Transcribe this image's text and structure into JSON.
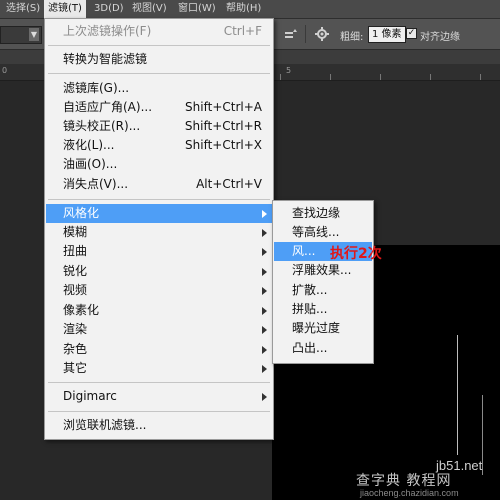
{
  "menubar": {
    "items": [
      {
        "label": "选择(S)"
      },
      {
        "label": "滤镜(T)"
      },
      {
        "label": "3D(D)"
      },
      {
        "label": "视图(V)"
      },
      {
        "label": "窗口(W)"
      },
      {
        "label": "帮助(H)"
      }
    ]
  },
  "options": {
    "width_label": "粗细:",
    "width_value": "1 像素",
    "align_edges_label": "对齐边缘",
    "align_edges_checked": "✓"
  },
  "ruler": {
    "numbers": [
      "0",
      "5"
    ]
  },
  "filter_menu": {
    "items": [
      {
        "label": "上次滤镜操作(F)",
        "shortcut": "Ctrl+F"
      },
      {
        "label": "转换为智能滤镜",
        "shortcut": ""
      },
      {
        "label": "滤镜库(G)...",
        "shortcut": ""
      },
      {
        "label": "自适应广角(A)...",
        "shortcut": "Shift+Ctrl+A"
      },
      {
        "label": "镜头校正(R)...",
        "shortcut": "Shift+Ctrl+R"
      },
      {
        "label": "液化(L)...",
        "shortcut": "Shift+Ctrl+X"
      },
      {
        "label": "油画(O)...",
        "shortcut": ""
      },
      {
        "label": "消失点(V)...",
        "shortcut": "Alt+Ctrl+V"
      },
      {
        "label": "风格化",
        "shortcut": ""
      },
      {
        "label": "模糊",
        "shortcut": ""
      },
      {
        "label": "扭曲",
        "shortcut": ""
      },
      {
        "label": "锐化",
        "shortcut": ""
      },
      {
        "label": "视频",
        "shortcut": ""
      },
      {
        "label": "像素化",
        "shortcut": ""
      },
      {
        "label": "渲染",
        "shortcut": ""
      },
      {
        "label": "杂色",
        "shortcut": ""
      },
      {
        "label": "其它",
        "shortcut": ""
      },
      {
        "label": "Digimarc",
        "shortcut": ""
      },
      {
        "label": "浏览联机滤镜...",
        "shortcut": ""
      }
    ]
  },
  "stylize_submenu": {
    "items": [
      {
        "label": "查找边缘"
      },
      {
        "label": "等高线..."
      },
      {
        "label": "风..."
      },
      {
        "label": "浮雕效果..."
      },
      {
        "label": "扩散..."
      },
      {
        "label": "拼贴..."
      },
      {
        "label": "曝光过度"
      },
      {
        "label": "凸出..."
      }
    ]
  },
  "annotation": {
    "text": "执行2次",
    "color": "#e01818"
  },
  "watermark": {
    "site": "jb51.net",
    "text": "查字典 教程网",
    "url": "jiaocheng.chazidian.com"
  },
  "colors": {
    "highlight": "#4e9ef6",
    "menu_bg": "#f2f2f2"
  }
}
